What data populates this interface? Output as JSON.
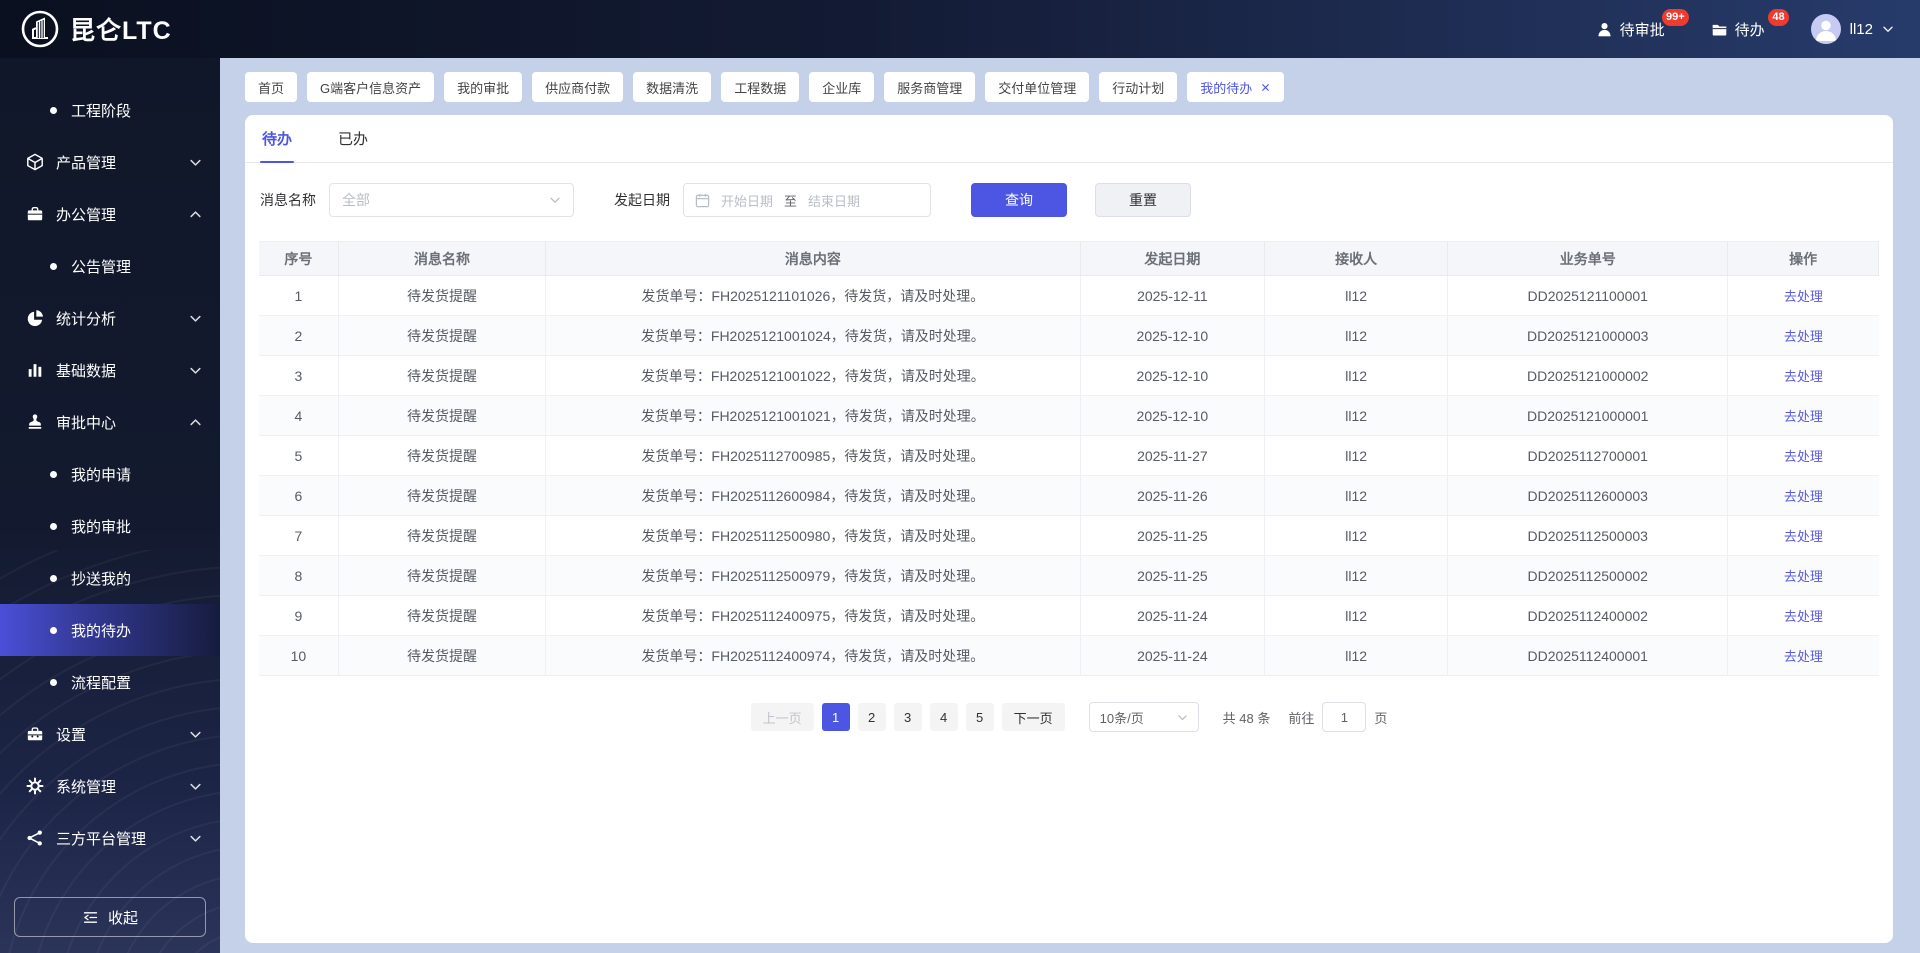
{
  "colors": {
    "accent": "#4d56e3",
    "link": "#5a5ce8",
    "badge": "#ee3b30",
    "sidebar_selected": "#4a4fd8",
    "page_background": "#c5d1e8"
  },
  "topbar": {
    "brand": "昆仑LTC",
    "pending_approvals": {
      "label": "待审批",
      "badge": "99+"
    },
    "todos": {
      "label": "待办",
      "badge": "48"
    },
    "user": {
      "name": "ll12"
    }
  },
  "sidebar": {
    "items": [
      {
        "type": "sub",
        "label": "工程阶段"
      },
      {
        "type": "group",
        "icon": "product",
        "label": "产品管理",
        "chevron": "chevron-down"
      },
      {
        "type": "group",
        "icon": "briefcase",
        "label": "办公管理",
        "chevron": "chevron-up"
      },
      {
        "type": "sub",
        "label": "公告管理"
      },
      {
        "type": "group",
        "icon": "pie-chart",
        "label": "统计分析",
        "chevron": "chevron-down"
      },
      {
        "type": "group",
        "icon": "bar-chart",
        "label": "基础数据",
        "chevron": "chevron-down"
      },
      {
        "type": "group",
        "icon": "stamp",
        "label": "审批中心",
        "chevron": "chevron-up"
      },
      {
        "type": "sub",
        "label": "我的申请"
      },
      {
        "type": "sub",
        "label": "我的审批"
      },
      {
        "type": "sub",
        "label": "抄送我的"
      },
      {
        "type": "sub",
        "label": "我的待办",
        "selected": true
      },
      {
        "type": "sub",
        "label": "流程配置"
      },
      {
        "type": "group",
        "icon": "toolbox",
        "label": "设置",
        "chevron": "chevron-down"
      },
      {
        "type": "group",
        "icon": "gear",
        "label": "系统管理",
        "chevron": "chevron-down"
      },
      {
        "type": "group",
        "icon": "share",
        "label": "三方平台管理",
        "chevron": "chevron-down"
      }
    ],
    "collapse_label": "收起"
  },
  "tags": [
    {
      "label": "首页"
    },
    {
      "label": "G端客户信息资产"
    },
    {
      "label": "我的审批"
    },
    {
      "label": "供应商付款"
    },
    {
      "label": "数据清洗"
    },
    {
      "label": "工程数据"
    },
    {
      "label": "企业库"
    },
    {
      "label": "服务商管理"
    },
    {
      "label": "交付单位管理"
    },
    {
      "label": "行动计划"
    },
    {
      "label": "我的待办",
      "active": true,
      "closable": true
    }
  ],
  "tabs": [
    {
      "label": "待办",
      "active": true
    },
    {
      "label": "已办"
    }
  ],
  "filters": {
    "message_name_label": "消息名称",
    "message_name_value": "全部",
    "date_label": "发起日期",
    "date_start_placeholder": "开始日期",
    "date_separator": "至",
    "date_end_placeholder": "结束日期",
    "search_label": "查询",
    "reset_label": "重置"
  },
  "table": {
    "columns": [
      "序号",
      "消息名称",
      "消息内容",
      "发起日期",
      "接收人",
      "业务单号",
      "操作"
    ],
    "action_label": "去处理",
    "rows": [
      [
        "1",
        "待发货提醒",
        "发货单号：FH2025121101026，待发货，请及时处理。",
        "2025-12-11",
        "ll12",
        "DD2025121100001"
      ],
      [
        "2",
        "待发货提醒",
        "发货单号：FH2025121001024，待发货，请及时处理。",
        "2025-12-10",
        "ll12",
        "DD2025121000003"
      ],
      [
        "3",
        "待发货提醒",
        "发货单号：FH2025121001022，待发货，请及时处理。",
        "2025-12-10",
        "ll12",
        "DD2025121000002"
      ],
      [
        "4",
        "待发货提醒",
        "发货单号：FH2025121001021，待发货，请及时处理。",
        "2025-12-10",
        "ll12",
        "DD2025121000001"
      ],
      [
        "5",
        "待发货提醒",
        "发货单号：FH2025112700985，待发货，请及时处理。",
        "2025-11-27",
        "ll12",
        "DD2025112700001"
      ],
      [
        "6",
        "待发货提醒",
        "发货单号：FH2025112600984，待发货，请及时处理。",
        "2025-11-26",
        "ll12",
        "DD2025112600003"
      ],
      [
        "7",
        "待发货提醒",
        "发货单号：FH2025112500980，待发货，请及时处理。",
        "2025-11-25",
        "ll12",
        "DD2025112500003"
      ],
      [
        "8",
        "待发货提醒",
        "发货单号：FH2025112500979，待发货，请及时处理。",
        "2025-11-25",
        "ll12",
        "DD2025112500002"
      ],
      [
        "9",
        "待发货提醒",
        "发货单号：FH2025112400975，待发货，请及时处理。",
        "2025-11-24",
        "ll12",
        "DD2025112400002"
      ],
      [
        "10",
        "待发货提醒",
        "发货单号：FH2025112400974，待发货，请及时处理。",
        "2025-11-24",
        "ll12",
        "DD2025112400001"
      ]
    ]
  },
  "pagination": {
    "prev_label": "上一页",
    "next_label": "下一页",
    "pages": [
      {
        "label": "1",
        "active": true
      },
      {
        "label": "2"
      },
      {
        "label": "3"
      },
      {
        "label": "4"
      },
      {
        "label": "5"
      }
    ],
    "page_size": "10条/页",
    "total": "共 48 条",
    "goto_label": "前往",
    "goto_value": "1",
    "goto_unit": "页"
  }
}
